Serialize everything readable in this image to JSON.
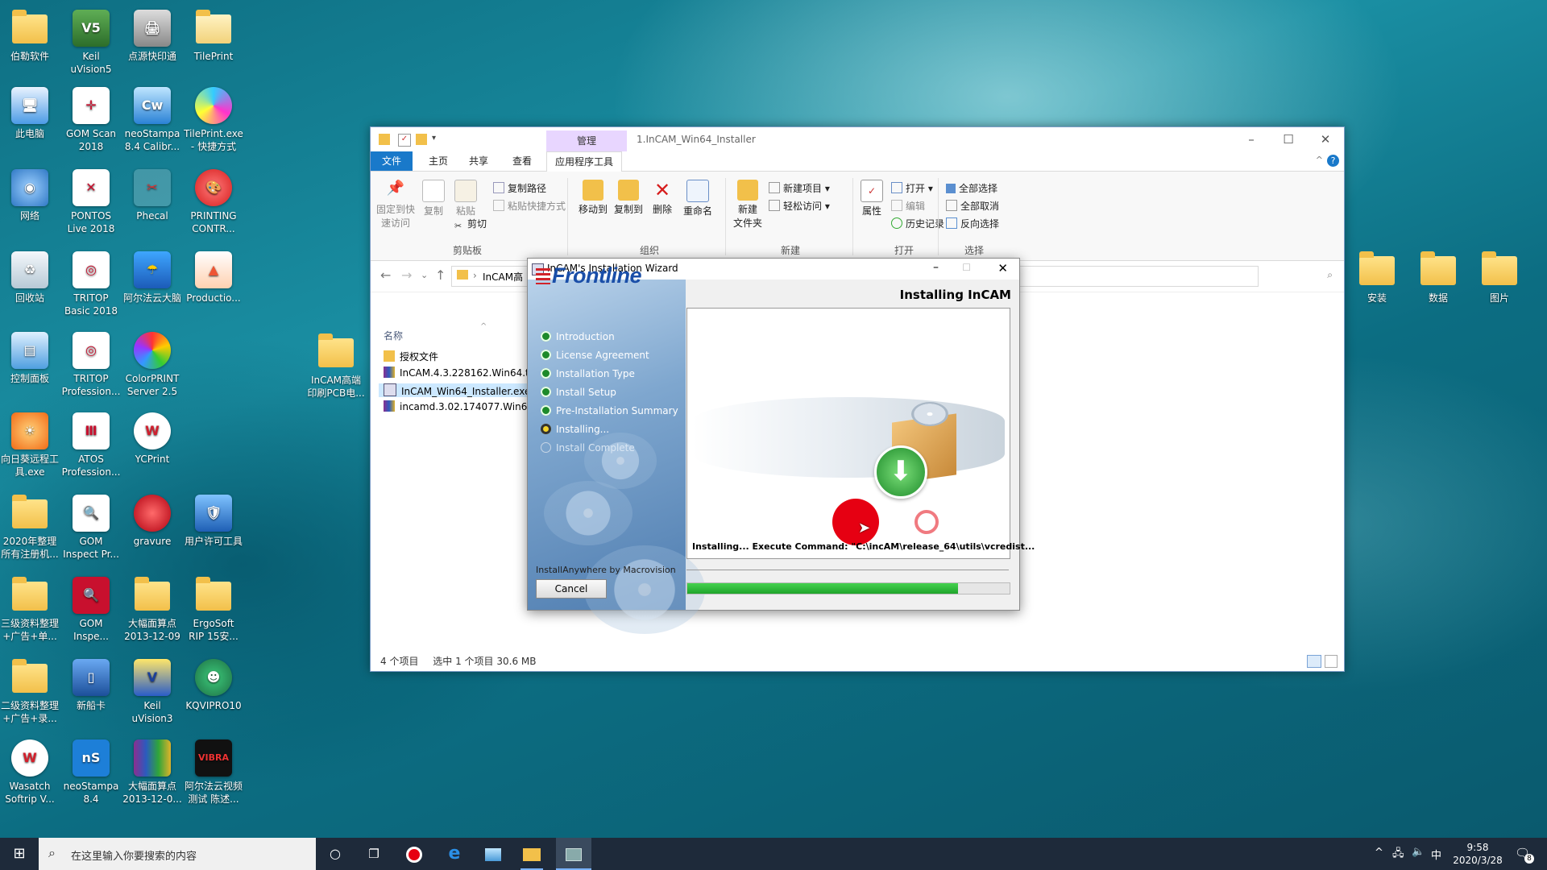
{
  "desktop": {
    "icons": [
      {
        "label": "伯勒软件"
      },
      {
        "label": "Keil\nuVision5"
      },
      {
        "label": "点源快印通"
      },
      {
        "label": "TilePrint"
      },
      {
        "label": "此电脑"
      },
      {
        "label": "GOM Scan\n2018"
      },
      {
        "label": "neoStampa\n8.4 Calibr..."
      },
      {
        "label": "TilePrint.exe\n- 快捷方式"
      },
      {
        "label": "网络"
      },
      {
        "label": "PONTOS\nLive 2018"
      },
      {
        "label": "Phecal"
      },
      {
        "label": "PRINTING\nCONTR..."
      },
      {
        "label": "回收站"
      },
      {
        "label": "TRITOP\nBasic 2018"
      },
      {
        "label": "阿尔法云大脑"
      },
      {
        "label": "Productio..."
      },
      {
        "label": "控制面板"
      },
      {
        "label": "TRITOP\nProfession..."
      },
      {
        "label": "ColorPRINT\nServer 2.5"
      },
      {
        "label": "InCAM高端\n印刷PCB电..."
      },
      {
        "label": "向日葵远程工\n具.exe"
      },
      {
        "label": "ATOS\nProfession..."
      },
      {
        "label": "YCPrint"
      },
      {
        "label": "2020年整理\n所有注册机..."
      },
      {
        "label": "GOM\nInspect Pr..."
      },
      {
        "label": "gravure"
      },
      {
        "label": "用户许可工具"
      },
      {
        "label": "三级资料整理\n+广告+单..."
      },
      {
        "label": "GOM\nInspe..."
      },
      {
        "label": "大幅面算点\n2013-12-09"
      },
      {
        "label": "ErgoSoft\nRIP 15安..."
      },
      {
        "label": "二级资料整理\n+广告+录..."
      },
      {
        "label": "新船卡"
      },
      {
        "label": "Keil\nuVision3"
      },
      {
        "label": "KQVIPRO10"
      },
      {
        "label": "Wasatch\nSoftrip V..."
      },
      {
        "label": "neoStampa\n8.4"
      },
      {
        "label": "大幅面算点\n2013-12-0..."
      },
      {
        "label": "阿尔法云视频\n测试 陈述..."
      },
      {
        "label": "安装"
      },
      {
        "label": "数据"
      },
      {
        "label": "图片"
      }
    ]
  },
  "explorer": {
    "title": "1.InCAM_Win64_Installer",
    "manage_tab": "管理",
    "tabs": [
      "文件",
      "主页",
      "共享",
      "查看",
      "应用程序工具"
    ],
    "ribbon": {
      "pin": "固定到快\n速访问",
      "copy": "复制",
      "paste": "粘贴",
      "copy_path": "复制路径",
      "paste_shortcut": "粘贴快捷方式",
      "cut": "剪切",
      "group_clipboard": "剪贴板",
      "move_to": "移动到",
      "copy_to": "复制到",
      "delete": "删除",
      "rename": "重命名",
      "group_organize": "组织",
      "new_folder": "新建\n文件夹",
      "new_item": "新建项目",
      "easy_access": "轻松访问",
      "group_new": "新建",
      "properties": "属性",
      "open": "打开",
      "edit": "编辑",
      "history": "历史记录",
      "group_open": "打开",
      "select_all": "全部选择",
      "select_none": "全部取消",
      "invert": "反向选择",
      "group_select": "选择"
    },
    "address": "InCAM高",
    "column_name": "名称",
    "files": [
      "授权文件",
      "InCAM.4.3.228162.Win64.ta",
      "InCAM_Win64_Installer.exe",
      "incamd.3.02.174077.Win64.t"
    ],
    "status_count": "4 个项目",
    "status_selected": "选中 1 个项目  30.6 MB"
  },
  "wizard": {
    "title": "InCAM's Installation Wizard",
    "logo": "Frontline",
    "heading": "Installing InCAM",
    "steps": [
      {
        "label": "Introduction",
        "state": "done"
      },
      {
        "label": "License Agreement",
        "state": "done"
      },
      {
        "label": "Installation Type",
        "state": "done"
      },
      {
        "label": "Install Setup",
        "state": "done"
      },
      {
        "label": "Pre-Installation Summary",
        "state": "done"
      },
      {
        "label": "Installing...",
        "state": "current"
      },
      {
        "label": "Install Complete",
        "state": "pending"
      }
    ],
    "message": "Installing... Execute Command: \"C:\\incAM\\release_64\\utils\\vcredist...",
    "vendor": "InstallAnywhere by Macrovision",
    "cancel": "Cancel",
    "progress": 0.84
  },
  "taskbar": {
    "search_placeholder": "在这里输入你要搜索的内容",
    "time": "9:58",
    "date": "2020/3/28",
    "ime": "中",
    "notif_count": "8"
  }
}
